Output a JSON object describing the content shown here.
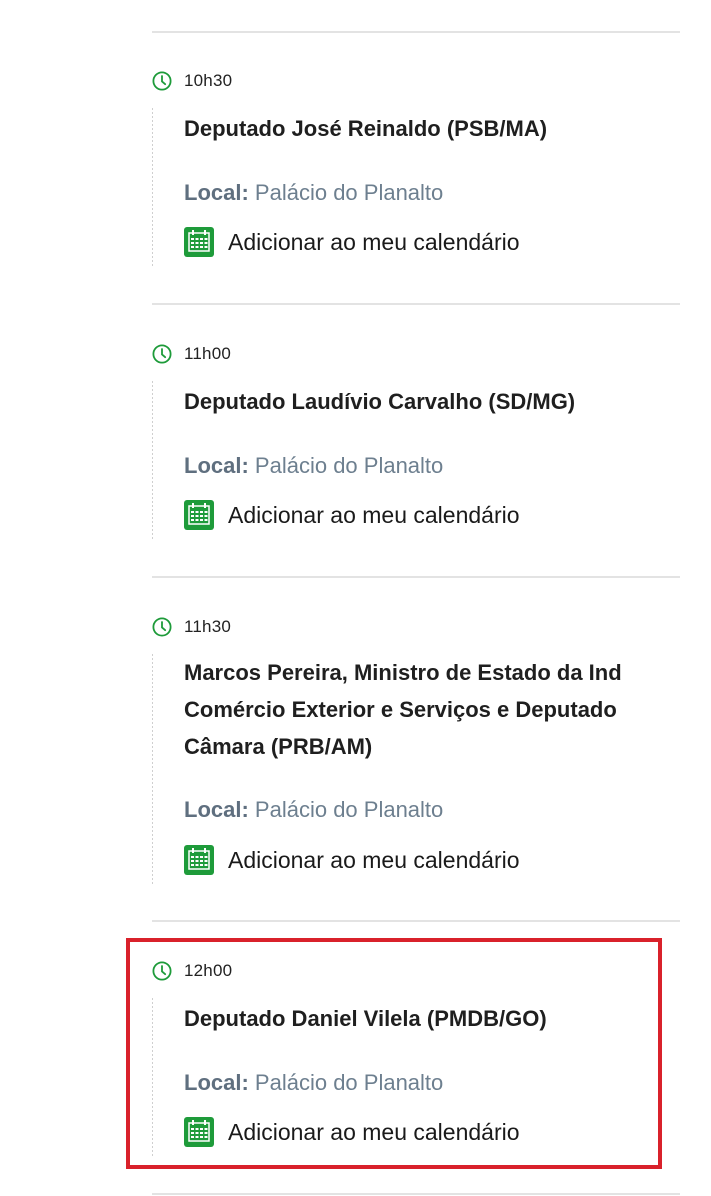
{
  "events": [
    {
      "time": "10h30",
      "title_lines": [
        "Deputado José Reinaldo (PSB/MA)"
      ],
      "local_label": "Local:",
      "local_value": "Palácio do Planalto",
      "calendar_label": "Adicionar ao meu calendário"
    },
    {
      "time": "11h00",
      "title_lines": [
        "Deputado Laudívio Carvalho (SD/MG)"
      ],
      "local_label": "Local:",
      "local_value": "Palácio do Planalto",
      "calendar_label": "Adicionar ao meu calendário"
    },
    {
      "time": "11h30",
      "title_lines": [
        "Marcos Pereira, Ministro de Estado da Ind",
        "Comércio Exterior e Serviços e Deputado",
        "Câmara (PRB/AM)"
      ],
      "local_label": "Local:",
      "local_value": "Palácio do Planalto",
      "calendar_label": "Adicionar ao meu calendário"
    },
    {
      "time": "12h00",
      "title_lines": [
        "Deputado Daniel Vilela (PMDB/GO)"
      ],
      "local_label": "Local:",
      "local_value": "Palácio do Planalto",
      "calendar_label": "Adicionar ao meu calendário",
      "highlighted": true
    }
  ],
  "colors": {
    "accent_green": "#1e9b3a",
    "highlight_red": "#d9212b",
    "local_text": "#6d7f8f"
  },
  "icons": {
    "time": "clock-icon",
    "calendar": "calendar-icon"
  }
}
